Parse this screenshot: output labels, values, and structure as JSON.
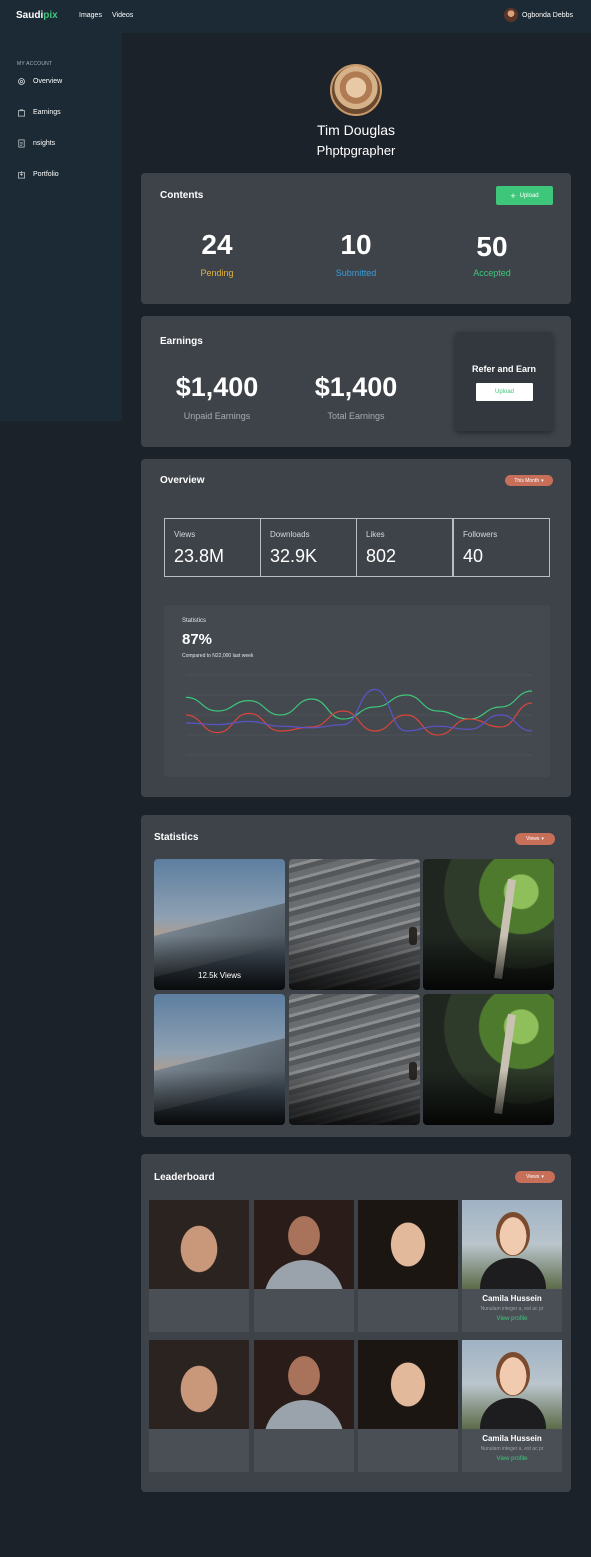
{
  "header": {
    "brand_main": "Saudi",
    "brand_accent": "pix",
    "nav": [
      "Images",
      "Videos"
    ],
    "user_name": "Ogbonda Debbs"
  },
  "sidebar": {
    "heading": "MY ACCOUNT",
    "items": [
      {
        "label": "Overview",
        "icon": "gear-icon"
      },
      {
        "label": "Earnings",
        "icon": "bag-icon"
      },
      {
        "label": "nsights",
        "icon": "document-icon"
      },
      {
        "label": "Portfolio",
        "icon": "portfolio-icon"
      }
    ]
  },
  "profile": {
    "name": "Tim Douglas",
    "role": "Phptpgrapher"
  },
  "contents": {
    "title": "Contents",
    "upload_label": "Upload",
    "stats": [
      {
        "value": "24",
        "label": "Pending",
        "color": "#e1b33c"
      },
      {
        "value": "10",
        "label": "Submitted",
        "color": "#3b9bd6"
      },
      {
        "value": "50",
        "label": "Accepted",
        "color": "#3ec77a"
      }
    ]
  },
  "earnings": {
    "title": "Earnings",
    "unpaid_value": "$1,400",
    "unpaid_label": "Unpaid Earnings",
    "total_value": "$1,400",
    "total_label": "Total Earnings",
    "refer_title": "Refer and Earn",
    "refer_button": "Upload"
  },
  "overview": {
    "title": "Overview",
    "filter": "This Month",
    "metrics": [
      {
        "label": "Views",
        "value": "23.8M"
      },
      {
        "label": "Downloads",
        "value": "32.9K"
      },
      {
        "label": "Likes",
        "value": "802"
      },
      {
        "label": "Followers",
        "value": "40"
      }
    ],
    "chart_title": "Statistics",
    "chart_pct": "87%",
    "chart_note": "Compared to N22,000 last week"
  },
  "chart_data": {
    "type": "line",
    "title": "Statistics",
    "x": [
      0,
      1,
      2,
      3,
      4,
      5,
      6,
      7,
      8,
      9,
      10,
      11
    ],
    "ylim": [
      0,
      100
    ],
    "grid": true,
    "series": [
      {
        "color": "#3ec77a",
        "values": [
          72,
          55,
          68,
          50,
          70,
          45,
          60,
          75,
          55,
          45,
          60,
          80
        ]
      },
      {
        "color": "#d9453a",
        "values": [
          50,
          28,
          52,
          30,
          35,
          55,
          30,
          50,
          25,
          45,
          35,
          65
        ]
      },
      {
        "color": "#5b54c9",
        "values": [
          40,
          38,
          42,
          36,
          34,
          38,
          82,
          30,
          36,
          32,
          50,
          30
        ]
      }
    ]
  },
  "statistics": {
    "title": "Statistics",
    "filter": "Views",
    "tiles": [
      {
        "views": "12.5k Views"
      },
      {
        "views": ""
      },
      {
        "views": ""
      },
      {
        "views": ""
      },
      {
        "views": ""
      },
      {
        "views": ""
      }
    ]
  },
  "leaderboard": {
    "title": "Leaderboard",
    "filter": "Views",
    "featured": {
      "name": "Camila Hussein",
      "desc": "Nunulam integer a, est ac pr",
      "link": "View profile"
    }
  }
}
